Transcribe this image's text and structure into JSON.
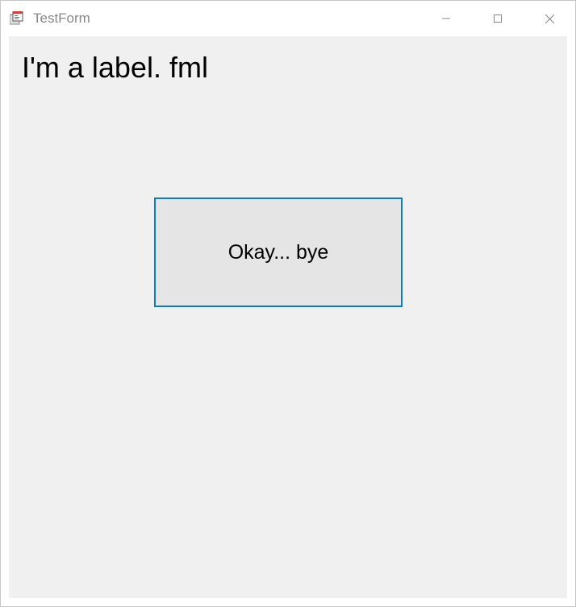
{
  "window": {
    "title": "TestForm"
  },
  "form": {
    "label_text": "I'm a label. fml",
    "button_label": "Okay... bye"
  }
}
